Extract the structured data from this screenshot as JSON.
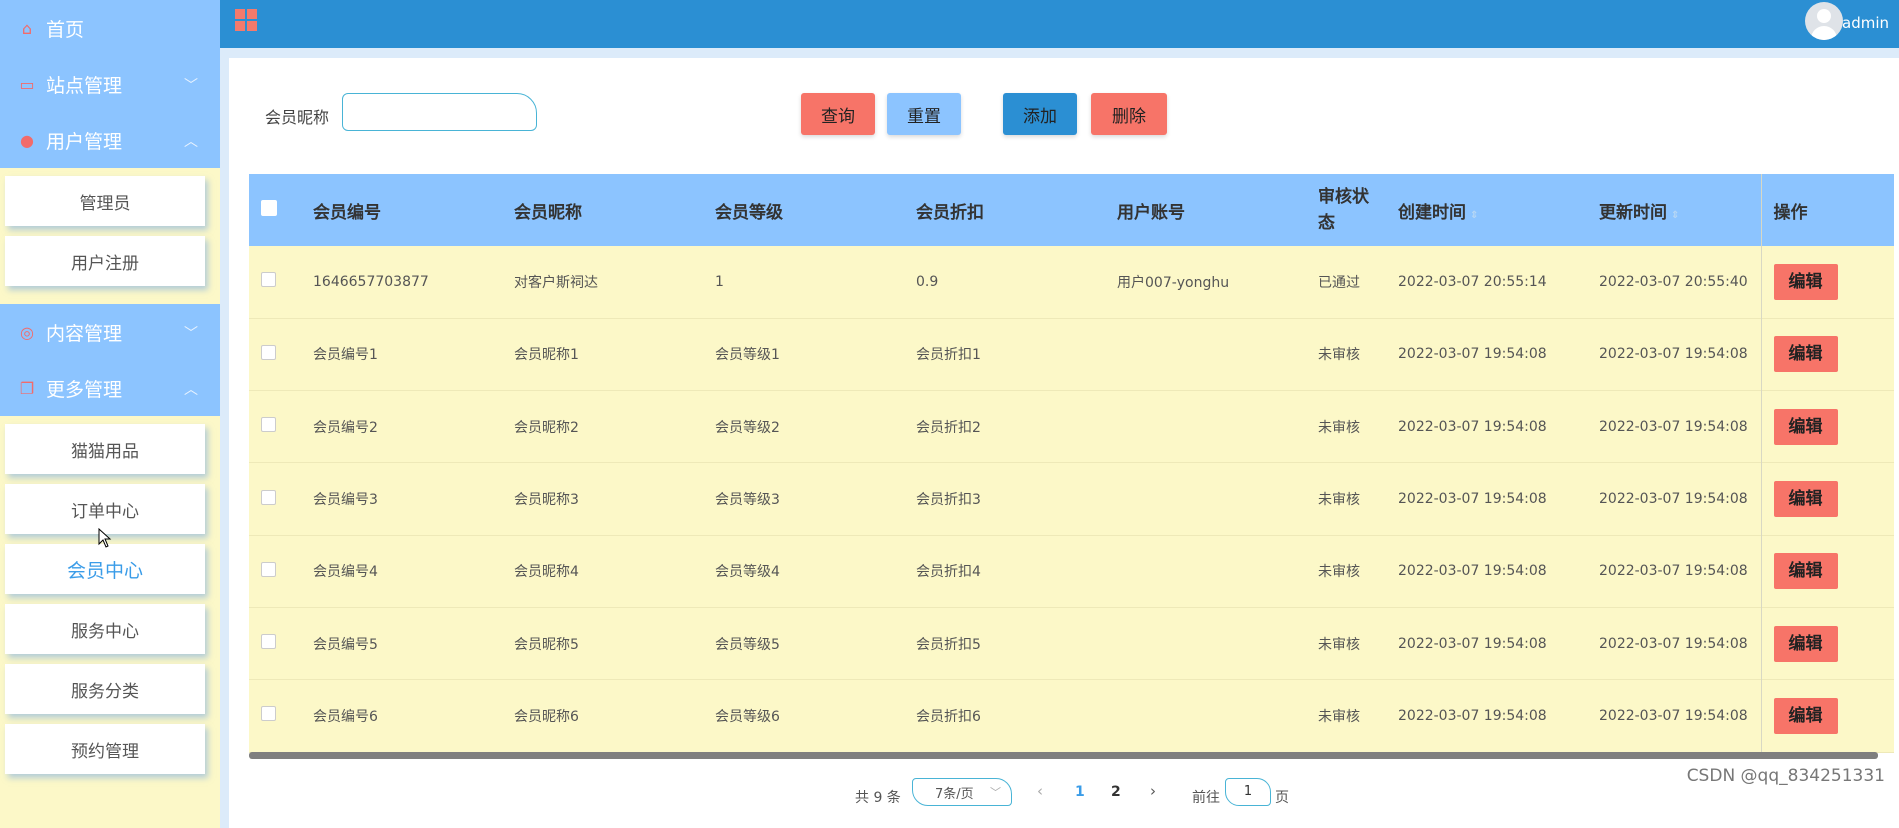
{
  "sidebar": {
    "home": "首页",
    "site_mgmt": "站点管理",
    "user_mgmt": "用户管理",
    "user_items": [
      "管理员",
      "用户注册"
    ],
    "content_mgmt": "内容管理",
    "more_mgmt": "更多管理",
    "more_items": [
      "猫猫用品",
      "订单中心",
      "会员中心",
      "服务中心",
      "服务分类",
      "预约管理"
    ],
    "active_item": "会员中心"
  },
  "header": {
    "username": "admin"
  },
  "search": {
    "label": "会员昵称",
    "value": ""
  },
  "buttons": {
    "query": "查询",
    "reset": "重置",
    "add": "添加",
    "delete": "删除"
  },
  "table": {
    "headers": [
      "会员编号",
      "会员昵称",
      "会员等级",
      "会员折扣",
      "用户账号",
      "审核状态",
      "创建时间",
      "更新时间",
      "操作"
    ],
    "edit_label": "编辑",
    "rows": [
      [
        "1646657703877",
        "对客户斯祠达",
        "1",
        "0.9",
        "用户007-yonghu",
        "已通过",
        "2022-03-07 20:55:14",
        "2022-03-07 20:55:40"
      ],
      [
        "会员编号1",
        "会员昵称1",
        "会员等级1",
        "会员折扣1",
        "",
        "未审核",
        "2022-03-07 19:54:08",
        "2022-03-07 19:54:08"
      ],
      [
        "会员编号2",
        "会员昵称2",
        "会员等级2",
        "会员折扣2",
        "",
        "未审核",
        "2022-03-07 19:54:08",
        "2022-03-07 19:54:08"
      ],
      [
        "会员编号3",
        "会员昵称3",
        "会员等级3",
        "会员折扣3",
        "",
        "未审核",
        "2022-03-07 19:54:08",
        "2022-03-07 19:54:08"
      ],
      [
        "会员编号4",
        "会员昵称4",
        "会员等级4",
        "会员折扣4",
        "",
        "未审核",
        "2022-03-07 19:54:08",
        "2022-03-07 19:54:08"
      ],
      [
        "会员编号5",
        "会员昵称5",
        "会员等级5",
        "会员折扣5",
        "",
        "未审核",
        "2022-03-07 19:54:08",
        "2022-03-07 19:54:08"
      ],
      [
        "会员编号6",
        "会员昵称6",
        "会员等级6",
        "会员折扣6",
        "",
        "未审核",
        "2022-03-07 19:54:08",
        "2022-03-07 19:54:08"
      ]
    ]
  },
  "pagination": {
    "total_text": "共 9 条",
    "page_size": "7条/页",
    "pages": [
      "1",
      "2"
    ],
    "current_page": "1",
    "goto_prefix": "前往",
    "goto_value": "1",
    "goto_suffix": "页"
  },
  "watermark": "CSDN @qq_834251331",
  "colors": {
    "sidebar_bg": "#fcf8c8",
    "menu_header": "#8cc4ff",
    "topbar": "#2b8fd3",
    "accent_red": "#f77468",
    "active_text": "#3a9ce8"
  },
  "icons": {
    "home": "home-icon",
    "site": "monitor-icon",
    "user": "user-icon",
    "content": "chat-icon",
    "more": "copy-icon",
    "menu_toggle": "grid-icon"
  }
}
